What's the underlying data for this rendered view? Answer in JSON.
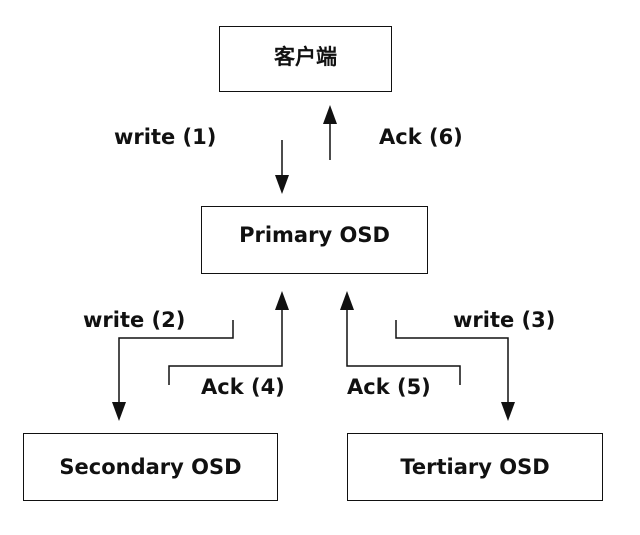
{
  "nodes": {
    "client": "客户端",
    "primary": "Primary OSD",
    "secondary": "Secondary OSD",
    "tertiary": "Tertiary OSD"
  },
  "edges": {
    "write1": "write (1)",
    "ack6": "Ack (6)",
    "write2": "write (2)",
    "ack4": "Ack (4)",
    "ack5": "Ack (5)",
    "write3": "write (3)"
  },
  "colors": {
    "stroke": "#111111",
    "background": "#ffffff"
  }
}
